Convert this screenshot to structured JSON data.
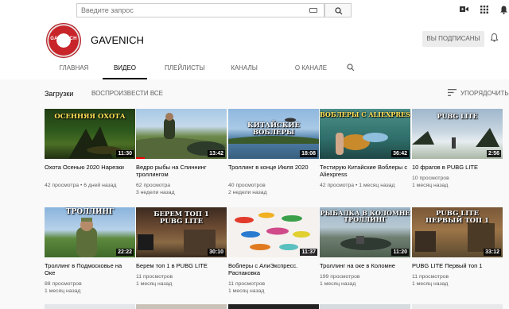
{
  "search": {
    "placeholder": "Введите запрос"
  },
  "channel": {
    "avatar_text": "GAVENICH",
    "name": "GAVENICH",
    "subscribed_label": "ВЫ ПОДПИСАНЫ"
  },
  "tabs": [
    "ГЛАВНАЯ",
    "ВИДЕО",
    "ПЛЕЙЛИСТЫ",
    "КАНАЛЫ",
    "О КАНАЛЕ"
  ],
  "section": {
    "uploads_label": "Загрузки",
    "play_all_label": "ВОСПРОИЗВЕСТИ ВСЕ",
    "sort_label": "УПОРЯДОЧИТЬ"
  },
  "videos": [
    {
      "thumb_text": "ОСЕННЯЯ ОХОТА",
      "duration": "11:30",
      "title": "Охота Осенью 2020 Нарезки",
      "meta1": "42 просмотра • 6 дней назад",
      "meta2": "",
      "watched_fraction": 0
    },
    {
      "thumb_text": "",
      "duration": "13:42",
      "title": "Ведро рыбы на Спиннинг троллингом",
      "meta1": "62 просмотра",
      "meta2": "3 недели назад",
      "watched_fraction": 0.1
    },
    {
      "thumb_text": "КИТАЙСКИЕ ВОБЛЕРЫ",
      "duration": "18:08",
      "title": "Троллинг в конце Июля 2020",
      "meta1": "40 просмотров",
      "meta2": "2 недели назад",
      "watched_fraction": 0
    },
    {
      "thumb_text": "ВОБЛЕРЫ С ALIEXPRES",
      "duration": "36:42",
      "title": "Тестирую Китайские Воблеры с Aliexpress",
      "meta1": "42 просмотра • 1 месяц назад",
      "meta2": "",
      "watched_fraction": 0
    },
    {
      "thumb_text": "PUBG LITE",
      "duration": "2:56",
      "title": "10 фрагов в PUBG LITE",
      "meta1": "10 просмотров",
      "meta2": "1 месяц назад",
      "watched_fraction": 0
    },
    {
      "thumb_text": "ТРОЛЛИНГ",
      "duration": "22:22",
      "title": "Троллинг в Подмосковье на Оке",
      "meta1": "88 просмотров",
      "meta2": "1 месяц назад",
      "watched_fraction": 0
    },
    {
      "thumb_text": "БЕРЕМ ТОП 1 PUBG LITE",
      "duration": "30:10",
      "title": "Берем топ 1 в PUBG LITE",
      "meta1": "11 просмотров",
      "meta2": "1 месяц назад",
      "watched_fraction": 0
    },
    {
      "thumb_text": "",
      "duration": "11:37",
      "title": "Воблеры с АлиЭкспресс. Распаковка",
      "meta1": "11 просмотров",
      "meta2": "1 месяц назад",
      "watched_fraction": 0
    },
    {
      "thumb_text": "РЫБАЛКА В КОЛОМНЕ ТРОЛЛИНГ",
      "duration": "11:20",
      "title": "Троллинг на оке в Коломне",
      "meta1": "199 просмотров",
      "meta2": "1 месяц назад",
      "watched_fraction": 0
    },
    {
      "thumb_text": "PUBG LITE ПЕРВЫЙ ТОП 1",
      "duration": "33:12",
      "title": "PUBG LITE Первый топ 1",
      "meta1": "11 просмотров",
      "meta2": "1 месяц назад",
      "watched_fraction": 0
    }
  ],
  "icons": {
    "search": "search-icon",
    "keyboard": "keyboard-icon",
    "create": "video-camera-icon",
    "apps": "apps-grid-icon",
    "notifications": "bell-icon",
    "sort": "sort-icon"
  },
  "colors": {
    "accent": "#cc0000",
    "progress": "#ee0000",
    "subscribed_bg": "#ececec"
  }
}
